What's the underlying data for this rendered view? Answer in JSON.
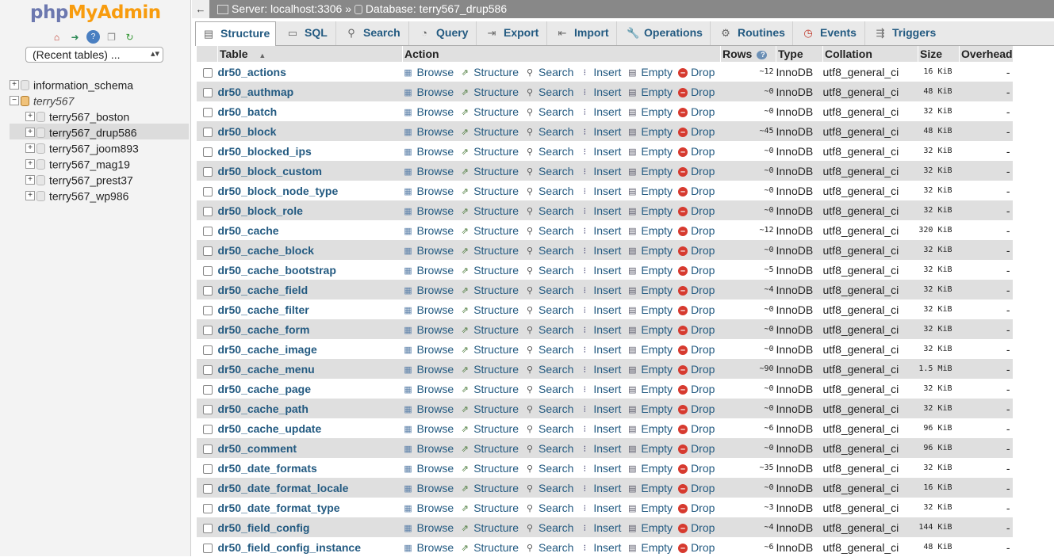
{
  "sidebar": {
    "logo_php": "php",
    "logo_my": "MyAdmin",
    "nav_icons": [
      "home-icon",
      "logout-icon",
      "help-icon",
      "docs-icon",
      "reload-icon"
    ],
    "recent_tables": "(Recent tables) ...",
    "databases": [
      {
        "label": "information_schema"
      },
      {
        "label": "terry567"
      },
      {
        "label": "terry567_boston"
      },
      {
        "label": "terry567_drup586"
      },
      {
        "label": "terry567_joom893"
      },
      {
        "label": "terry567_mag19"
      },
      {
        "label": "terry567_prest37"
      },
      {
        "label": "terry567_wp986"
      }
    ]
  },
  "breadcrumb": {
    "back": "←",
    "server": "Server: localhost:3306",
    "sep": "»",
    "database": "Database: terry567_drup586"
  },
  "tabs": [
    {
      "label": "Structure",
      "icon": "structure-icon"
    },
    {
      "label": "SQL",
      "icon": "sql-icon"
    },
    {
      "label": "Search",
      "icon": "search-icon"
    },
    {
      "label": "Query",
      "icon": "query-icon"
    },
    {
      "label": "Export",
      "icon": "export-icon"
    },
    {
      "label": "Import",
      "icon": "import-icon"
    },
    {
      "label": "Operations",
      "icon": "wrench-icon"
    },
    {
      "label": "Routines",
      "icon": "routines-icon"
    },
    {
      "label": "Events",
      "icon": "clock-icon"
    },
    {
      "label": "Triggers",
      "icon": "triggers-icon"
    }
  ],
  "table": {
    "headers": {
      "table": "Table",
      "action": "Action",
      "rows": "Rows",
      "type": "Type",
      "collation": "Collation",
      "size": "Size",
      "overhead": "Overhead"
    },
    "actions": [
      "Browse",
      "Structure",
      "Search",
      "Insert",
      "Empty",
      "Drop"
    ],
    "rows": [
      {
        "name": "dr50_actions",
        "rows": "~12",
        "type": "InnoDB",
        "collation": "utf8_general_ci",
        "size": "16 KiB",
        "overhead": "-"
      },
      {
        "name": "dr50_authmap",
        "rows": "~0",
        "type": "InnoDB",
        "collation": "utf8_general_ci",
        "size": "48 KiB",
        "overhead": "-"
      },
      {
        "name": "dr50_batch",
        "rows": "~0",
        "type": "InnoDB",
        "collation": "utf8_general_ci",
        "size": "32 KiB",
        "overhead": "-"
      },
      {
        "name": "dr50_block",
        "rows": "~45",
        "type": "InnoDB",
        "collation": "utf8_general_ci",
        "size": "48 KiB",
        "overhead": "-"
      },
      {
        "name": "dr50_blocked_ips",
        "rows": "~0",
        "type": "InnoDB",
        "collation": "utf8_general_ci",
        "size": "32 KiB",
        "overhead": "-"
      },
      {
        "name": "dr50_block_custom",
        "rows": "~0",
        "type": "InnoDB",
        "collation": "utf8_general_ci",
        "size": "32 KiB",
        "overhead": "-"
      },
      {
        "name": "dr50_block_node_type",
        "rows": "~0",
        "type": "InnoDB",
        "collation": "utf8_general_ci",
        "size": "32 KiB",
        "overhead": "-"
      },
      {
        "name": "dr50_block_role",
        "rows": "~0",
        "type": "InnoDB",
        "collation": "utf8_general_ci",
        "size": "32 KiB",
        "overhead": "-"
      },
      {
        "name": "dr50_cache",
        "rows": "~12",
        "type": "InnoDB",
        "collation": "utf8_general_ci",
        "size": "320 KiB",
        "overhead": "-"
      },
      {
        "name": "dr50_cache_block",
        "rows": "~0",
        "type": "InnoDB",
        "collation": "utf8_general_ci",
        "size": "32 KiB",
        "overhead": "-"
      },
      {
        "name": "dr50_cache_bootstrap",
        "rows": "~5",
        "type": "InnoDB",
        "collation": "utf8_general_ci",
        "size": "32 KiB",
        "overhead": "-"
      },
      {
        "name": "dr50_cache_field",
        "rows": "~4",
        "type": "InnoDB",
        "collation": "utf8_general_ci",
        "size": "32 KiB",
        "overhead": "-"
      },
      {
        "name": "dr50_cache_filter",
        "rows": "~0",
        "type": "InnoDB",
        "collation": "utf8_general_ci",
        "size": "32 KiB",
        "overhead": "-"
      },
      {
        "name": "dr50_cache_form",
        "rows": "~0",
        "type": "InnoDB",
        "collation": "utf8_general_ci",
        "size": "32 KiB",
        "overhead": "-"
      },
      {
        "name": "dr50_cache_image",
        "rows": "~0",
        "type": "InnoDB",
        "collation": "utf8_general_ci",
        "size": "32 KiB",
        "overhead": "-"
      },
      {
        "name": "dr50_cache_menu",
        "rows": "~90",
        "type": "InnoDB",
        "collation": "utf8_general_ci",
        "size": "1.5 MiB",
        "overhead": "-"
      },
      {
        "name": "dr50_cache_page",
        "rows": "~0",
        "type": "InnoDB",
        "collation": "utf8_general_ci",
        "size": "32 KiB",
        "overhead": "-"
      },
      {
        "name": "dr50_cache_path",
        "rows": "~0",
        "type": "InnoDB",
        "collation": "utf8_general_ci",
        "size": "32 KiB",
        "overhead": "-"
      },
      {
        "name": "dr50_cache_update",
        "rows": "~6",
        "type": "InnoDB",
        "collation": "utf8_general_ci",
        "size": "96 KiB",
        "overhead": "-"
      },
      {
        "name": "dr50_comment",
        "rows": "~0",
        "type": "InnoDB",
        "collation": "utf8_general_ci",
        "size": "96 KiB",
        "overhead": "-"
      },
      {
        "name": "dr50_date_formats",
        "rows": "~35",
        "type": "InnoDB",
        "collation": "utf8_general_ci",
        "size": "32 KiB",
        "overhead": "-"
      },
      {
        "name": "dr50_date_format_locale",
        "rows": "~0",
        "type": "InnoDB",
        "collation": "utf8_general_ci",
        "size": "16 KiB",
        "overhead": "-"
      },
      {
        "name": "dr50_date_format_type",
        "rows": "~3",
        "type": "InnoDB",
        "collation": "utf8_general_ci",
        "size": "32 KiB",
        "overhead": "-"
      },
      {
        "name": "dr50_field_config",
        "rows": "~4",
        "type": "InnoDB",
        "collation": "utf8_general_ci",
        "size": "144 KiB",
        "overhead": "-"
      },
      {
        "name": "dr50_field_config_instance",
        "rows": "~6",
        "type": "InnoDB",
        "collation": "utf8_general_ci",
        "size": "48 KiB",
        "overhead": "-"
      }
    ]
  },
  "colors": {
    "link": "#235a81",
    "topbar": "#888888",
    "row_even": "#dfdfdf",
    "drop": "#d63a2f"
  }
}
